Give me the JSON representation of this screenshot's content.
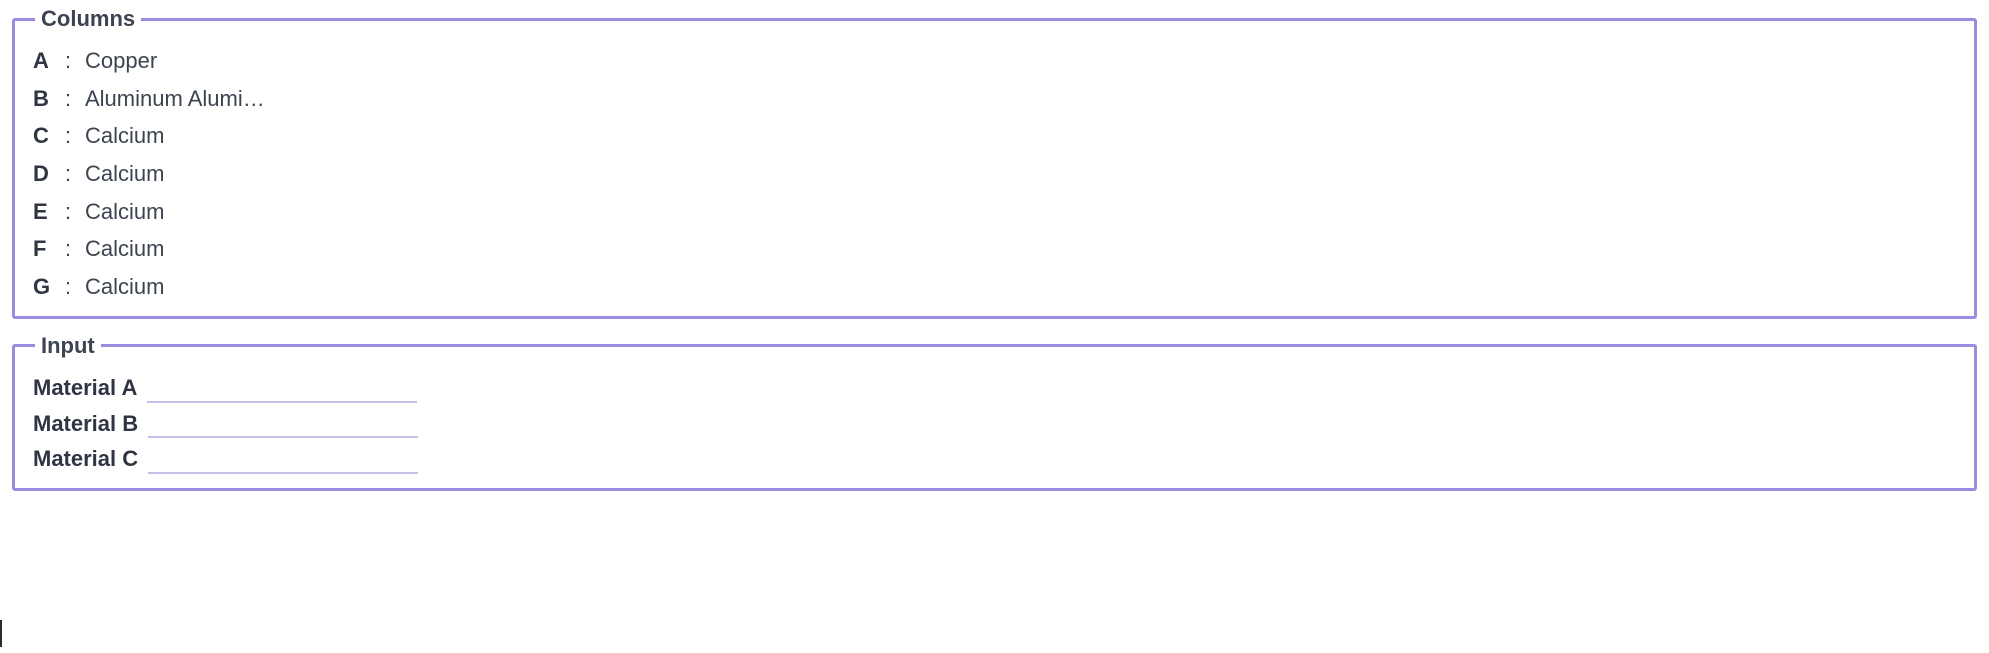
{
  "columns": {
    "legend": "Columns",
    "separator": ":",
    "items": [
      {
        "letter": "A",
        "value": "Copper"
      },
      {
        "letter": "B",
        "value": "Aluminum Alumi…"
      },
      {
        "letter": "C",
        "value": "Calcium"
      },
      {
        "letter": "D",
        "value": "Calcium"
      },
      {
        "letter": "E",
        "value": "Calcium"
      },
      {
        "letter": "F",
        "value": "Calcium"
      },
      {
        "letter": "G",
        "value": "Calcium"
      }
    ]
  },
  "input": {
    "legend": "Input",
    "fields": [
      {
        "label": "Material A",
        "value": ""
      },
      {
        "label": "Material B",
        "value": ""
      },
      {
        "label": "Material C",
        "value": ""
      }
    ]
  }
}
